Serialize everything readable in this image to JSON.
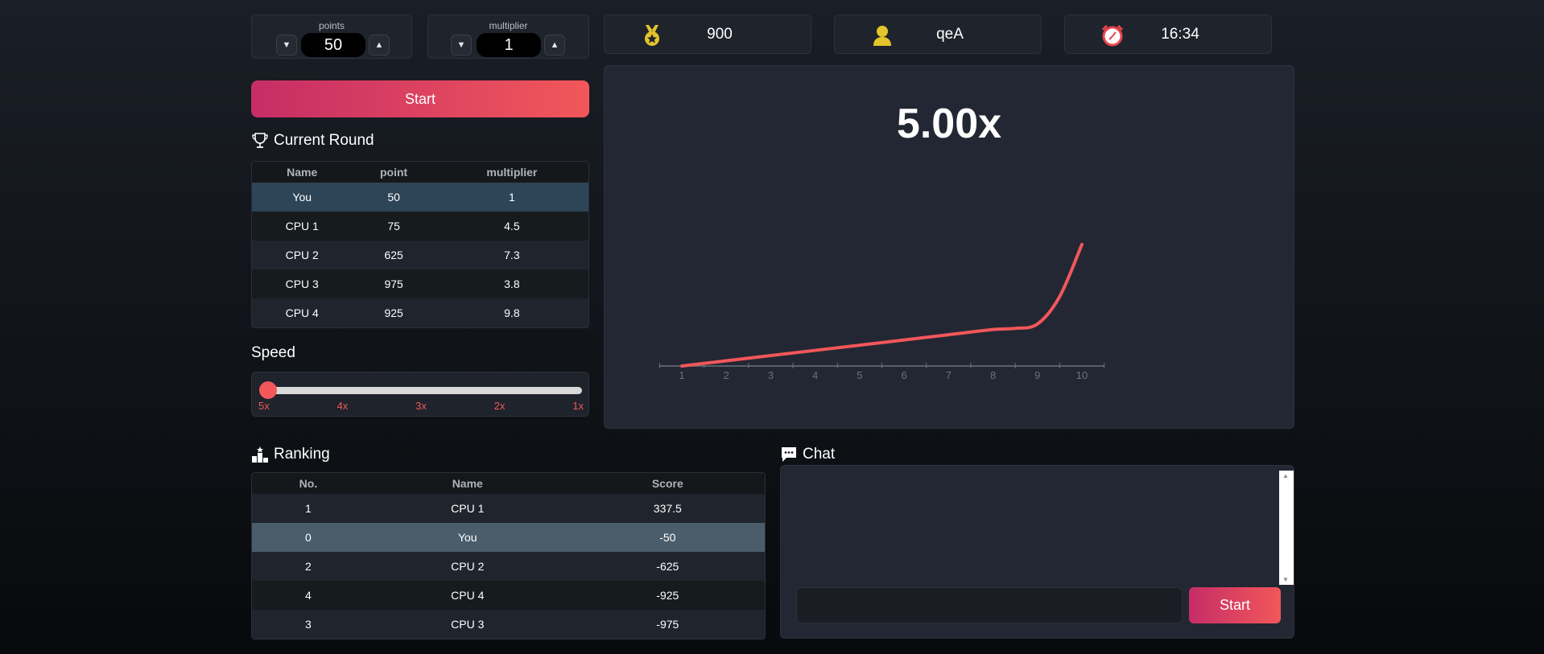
{
  "controls": {
    "points": {
      "label": "points",
      "value": "50",
      "down": "▼",
      "up": "▲"
    },
    "multiplier": {
      "label": "multiplier",
      "value": "1",
      "down": "▼",
      "up": "▲"
    }
  },
  "stats": {
    "score": {
      "icon": "medal-icon",
      "value": "900"
    },
    "user": {
      "icon": "user-icon",
      "value": "qeA"
    },
    "clock": {
      "icon": "alarm-clock-icon",
      "value": "16:34"
    }
  },
  "start_label": "Start",
  "current_round": {
    "title": "Current Round",
    "columns": [
      "Name",
      "point",
      "multiplier"
    ],
    "rows": [
      {
        "name": "You",
        "point": "50",
        "multiplier": "1"
      },
      {
        "name": "CPU 1",
        "point": "75",
        "multiplier": "4.5"
      },
      {
        "name": "CPU 2",
        "point": "625",
        "multiplier": "7.3"
      },
      {
        "name": "CPU 3",
        "point": "975",
        "multiplier": "3.8"
      },
      {
        "name": "CPU 4",
        "point": "925",
        "multiplier": "9.8"
      }
    ]
  },
  "speed": {
    "title": "Speed",
    "labels": [
      "5x",
      "4x",
      "3x",
      "2x",
      "1x"
    ],
    "selected": "5x"
  },
  "chart": {
    "multiplier_text": "5.00x",
    "accent": "#f2575a"
  },
  "chart_data": {
    "type": "line",
    "x": [
      1,
      2,
      3,
      4,
      5,
      6,
      7,
      8,
      8.5,
      9,
      9.5,
      10
    ],
    "y": [
      0,
      0.36,
      0.72,
      1.08,
      1.44,
      1.8,
      2.16,
      2.52,
      2.6,
      2.9,
      4.8,
      8.4
    ],
    "xticks": [
      "1",
      "2",
      "3",
      "4",
      "5",
      "6",
      "7",
      "8",
      "9",
      "10"
    ],
    "xlim": [
      0.5,
      10.5
    ],
    "ylim": [
      0,
      10
    ],
    "grid": false
  },
  "ranking": {
    "title": "Ranking",
    "columns": [
      "No.",
      "Name",
      "Score"
    ],
    "rows": [
      {
        "no": "1",
        "name": "CPU 1",
        "score": "337.5"
      },
      {
        "no": "0",
        "name": "You",
        "score": "-50"
      },
      {
        "no": "2",
        "name": "CPU 2",
        "score": "-625"
      },
      {
        "no": "4",
        "name": "CPU 4",
        "score": "-925"
      },
      {
        "no": "3",
        "name": "CPU 3",
        "score": "-975"
      }
    ]
  },
  "chat": {
    "title": "Chat",
    "send_label": "Start",
    "input_value": ""
  }
}
